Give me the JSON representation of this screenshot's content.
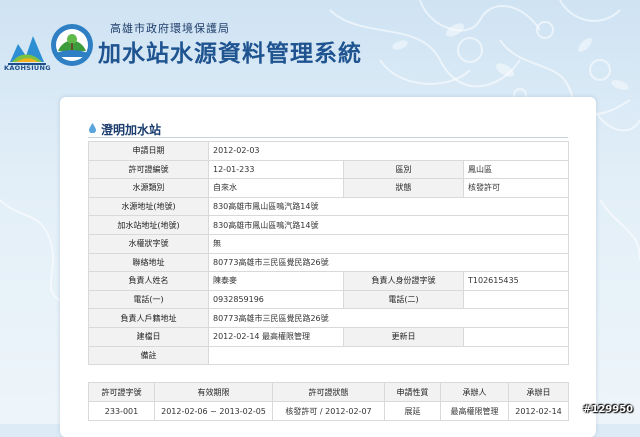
{
  "header": {
    "logo_text": "KAOHSIUNG",
    "agency": "高雄市政府環境保護局",
    "system_title": "加水站水源資料管理系統"
  },
  "section": {
    "title": "澄明加水站"
  },
  "detail": {
    "apply_date": {
      "label": "申請日期",
      "value": "2012-02-03"
    },
    "permit_no": {
      "label": "許可證編號",
      "value": "12-01-233"
    },
    "district": {
      "label": "區別",
      "value": "鳳山區"
    },
    "source_type": {
      "label": "水源類別",
      "value": "自來水"
    },
    "status": {
      "label": "狀態",
      "value": "核發許可"
    },
    "source_address": {
      "label": "水源地址(地號)",
      "value": "830高雄市鳳山區鳴汽路14號"
    },
    "station_address": {
      "label": "加水站地址(地號)",
      "value": "830高雄市鳳山區鳴汽路14號"
    },
    "water_right": {
      "label": "水權狀字號",
      "value": "無"
    },
    "contact_address": {
      "label": "聯絡地址",
      "value": "80773高雄市三民區覺民路26號"
    },
    "owner_name": {
      "label": "負責人姓名",
      "value": "陳泰麥"
    },
    "owner_id": {
      "label": "負責人身份證字號",
      "value": "T102615435"
    },
    "phone1": {
      "label": "電話(一)",
      "value": "0932859196"
    },
    "phone2": {
      "label": "電話(二)",
      "value": ""
    },
    "household_address": {
      "label": "負責人戶籍地址",
      "value": "80773高雄市三民區覺民路26號"
    },
    "created_date": {
      "label": "建檔日",
      "value": "2012-02-14  最高權限管理"
    },
    "updated_date": {
      "label": "更新日",
      "value": ""
    },
    "remarks": {
      "label": "備註",
      "value": ""
    }
  },
  "permit_table": {
    "headers": [
      "許可證字號",
      "有效期限",
      "許可證狀態",
      "申請性質",
      "承辦人",
      "承辦日"
    ],
    "rows": [
      [
        "233-001",
        "2012-02-06 ~ 2013-02-05",
        "核發許可 / 2012-02-07",
        "展延",
        "最高權限管理",
        "2012-02-14"
      ]
    ]
  },
  "watermark": "#129950",
  "colors": {
    "title_blue": "#1f5491",
    "label_bg": "#f2f2f2",
    "border": "#d9d9d9"
  }
}
